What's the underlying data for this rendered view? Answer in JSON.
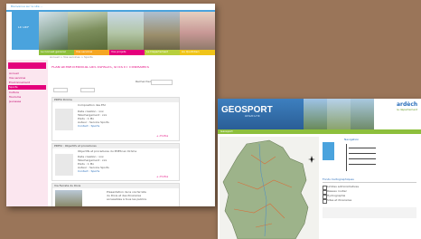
{
  "left_site": {
    "top_banner": "Bienvenue sur le site ...",
    "logo_text": "LE DÉP",
    "nav_tabs": [
      "Le Conseil général",
      "Vos services",
      "Vos projets",
      "Le Département",
      "Au Quotidien"
    ],
    "sidebar": [
      "Accueil",
      "Vos services",
      "Environnement",
      "Sports",
      "Culture",
      "Tourisme",
      "Jeunesse"
    ],
    "breadcrumb": "Accueil > Vos services > Sports",
    "page_title": "PLAN DÉPARTEMENTAL DES ESPACES, SITES ET ITINÉRAIRES",
    "search_label": "Rechercher",
    "panels": [
      {
        "title": "PDESI Drôme",
        "subtitle": "Composition des ESI",
        "lines": [
          "Date création : xxx",
          "Téléchargement : xxx",
          "Poids : 1 Mo",
          "Auteur : Service Sports",
          "Contact : Sports"
        ]
      },
      {
        "title": "PDESI : Objectifs et procédures",
        "subtitle": "Objectifs et procédures du PDESI en Drôme",
        "lines": [
          "Date création : xxx",
          "Téléchargement : xxx",
          "Poids : 1 Mo",
          "Auteur : Service Sports",
          "Contact : Sports"
        ]
      },
      {
        "title": "Via Ferrata du Diois",
        "subtitle": "",
        "lines": [
          "Présentation de la via ferrata",
          "du Diois et des itinéraires",
          "accessibles à tous les publics"
        ]
      }
    ],
    "more_link": "+ d'infos"
  },
  "right_site": {
    "logo": "GÉOSPORT",
    "logo_sub": "ARDÈCHE",
    "brand": "ardèch",
    "brand_sub": "le département",
    "menu_label": "Géosport",
    "nav_title": "Navigation",
    "layers_title": "Fonds Cartographiques",
    "layers": [
      "Limites administratives",
      "Réseau routier",
      "Hydrographie",
      "Sites et itinéraires"
    ]
  },
  "colors": {
    "accent_orange": "#f5a623",
    "accent_pink": "#e4007c",
    "accent_blue": "#4aa3dd",
    "accent_green": "#8dbf3c",
    "geosport_blue": "#2a6ebb"
  }
}
